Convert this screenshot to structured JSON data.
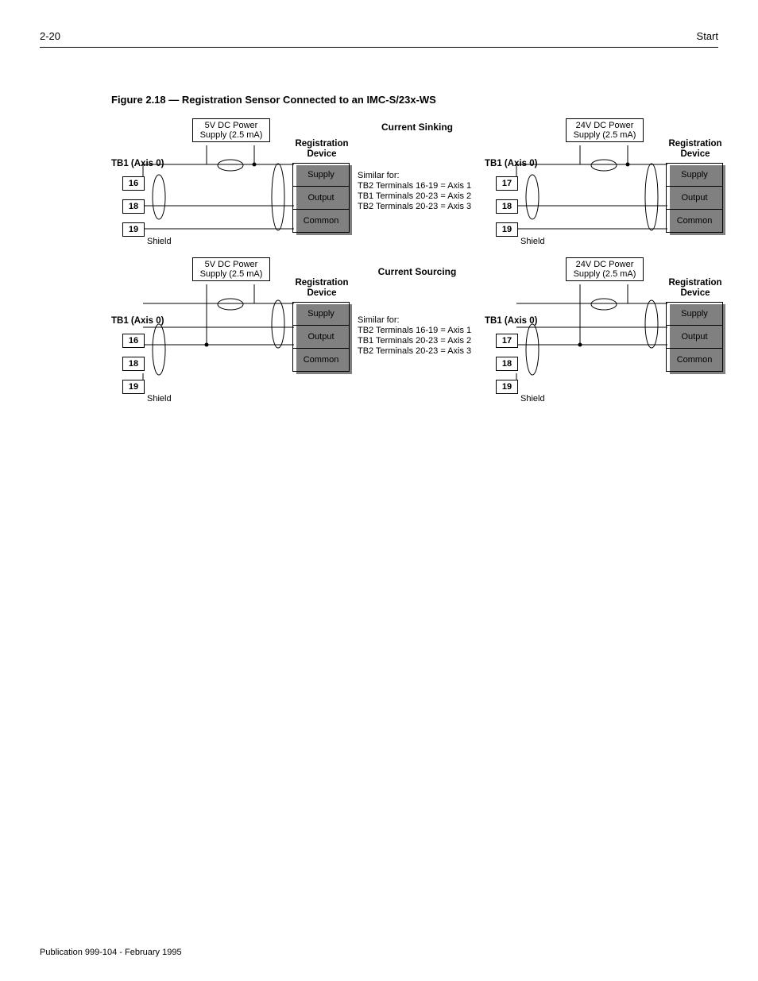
{
  "header": {
    "page_no": "2-20",
    "chapter": "Start"
  },
  "figure": {
    "caption": "Figure 2.18 — Registration Sensor Connected to an IMC-S/23x-WS"
  },
  "diagram": {
    "tb_label": "TB1 (Axis 0)",
    "shield": "Shield",
    "reg_label": "Registration Device",
    "reg_cells": {
      "supply": "Supply",
      "output": "Output",
      "common": "Common"
    },
    "ps5_l1": "5V DC Power",
    "ps5_l2": "Supply (2.5 mA)",
    "ps24_l1": "24V DC Power",
    "ps24_l2": "Supply (2.5 mA)",
    "sink_terms": {
      "a": "16",
      "b": "18",
      "c": "19"
    },
    "sink24_terms": {
      "a": "17",
      "b": "18",
      "c": "19"
    },
    "src_terms": {
      "a": "16",
      "b": "18",
      "c": "19"
    },
    "src24_terms": {
      "a": "17",
      "b": "18",
      "c": "19"
    }
  },
  "center": {
    "sink_head": "Current Sinking",
    "src_head": "Current Sourcing",
    "similar": "Similar for:",
    "l1": "TB2 Terminals 16-19 = Axis 1",
    "l2": "TB1 Terminals 20-23 = Axis 2",
    "l3": "TB2 Terminals 20-23 = Axis 3"
  },
  "footer": {
    "pub": "Publication 999-104 - February 1995"
  }
}
